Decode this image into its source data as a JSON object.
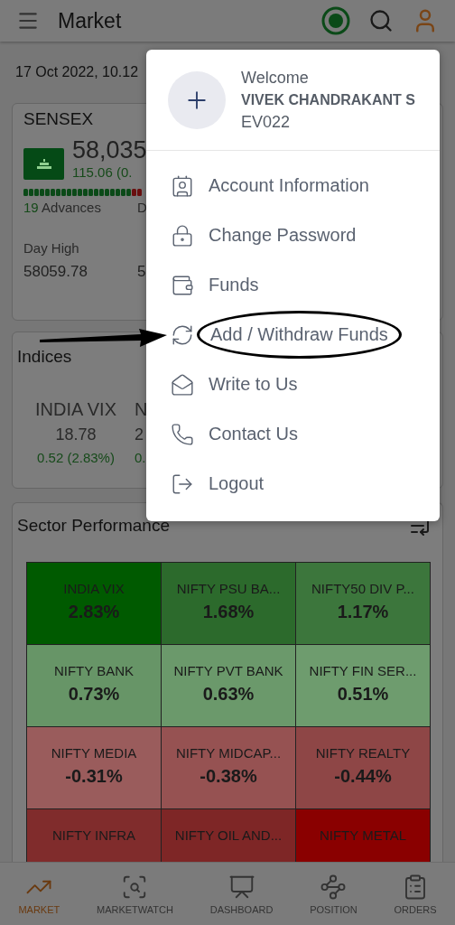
{
  "header": {
    "title": "Market"
  },
  "timestamp": "17 Oct 2022, 10.12",
  "sensex": {
    "name": "SENSEX",
    "price": "58,035",
    "change": "115.06 (0.",
    "advances": {
      "count": "19",
      "label": "Advances"
    },
    "declines_label": "D",
    "day_high": {
      "label": "Day High",
      "value": "58059.78"
    },
    "column_2_value": "5"
  },
  "indices": {
    "title": "Indices",
    "items": [
      {
        "name": "INDIA VIX",
        "value": "18.78",
        "change": "0.52 (2.83%)"
      },
      {
        "name": "N",
        "value": "2",
        "change": "0."
      }
    ]
  },
  "sector_performance": {
    "title": "Sector Performance",
    "cells": [
      {
        "name": "INDIA VIX",
        "change": "2.83%",
        "color": "#005a00"
      },
      {
        "name": "NIFTY PSU BA...",
        "change": "1.68%",
        "color": "#2c6a2c"
      },
      {
        "name": "NIFTY50 DIV P...",
        "change": "1.17%",
        "color": "#3c763c"
      },
      {
        "name": "NIFTY BANK",
        "change": "0.73%",
        "color": "#679567"
      },
      {
        "name": "NIFTY PVT BANK",
        "change": "0.63%",
        "color": "#6b996b"
      },
      {
        "name": "NIFTY FIN SER...",
        "change": "0.51%",
        "color": "#6e9c6e"
      },
      {
        "name": "NIFTY MEDIA",
        "change": "-0.31%",
        "color": "#9a5c5c"
      },
      {
        "name": "NIFTY MIDCAP...",
        "change": "-0.38%",
        "color": "#965252"
      },
      {
        "name": "NIFTY REALTY",
        "change": "-0.44%",
        "color": "#8e4646"
      },
      {
        "name": "NIFTY INFRA",
        "color": "#802c2c"
      },
      {
        "name": "NIFTY OIL AND...",
        "color": "#7e2626"
      },
      {
        "name": "NIFTY METAL",
        "color": "#8a0000"
      }
    ]
  },
  "bottom_nav": [
    {
      "label": "MARKET",
      "kind": "market",
      "selected": true
    },
    {
      "label": "MARKETWATCH",
      "kind": "watch",
      "selected": false
    },
    {
      "label": "DASHBOARD",
      "kind": "dashboard",
      "selected": false
    },
    {
      "label": "POSITION",
      "kind": "position",
      "selected": false
    },
    {
      "label": "ORDERS",
      "kind": "orders",
      "selected": false
    }
  ],
  "profile_menu": {
    "greeting": "Welcome",
    "name": "VIVEK CHANDRAKANT S",
    "client_id": "EV022",
    "items": [
      {
        "label": "Account Information",
        "kind": "account",
        "circled": false
      },
      {
        "label": "Change Password",
        "kind": "password",
        "circled": false
      },
      {
        "label": "Funds",
        "kind": "funds",
        "circled": false
      },
      {
        "label": "Add / Withdraw Funds",
        "kind": "transfer",
        "circled": true
      },
      {
        "label": "Write to Us",
        "kind": "mail",
        "circled": false
      },
      {
        "label": "Contact Us",
        "kind": "phone",
        "circled": false
      },
      {
        "label": "Logout",
        "kind": "logout",
        "circled": false
      }
    ]
  }
}
